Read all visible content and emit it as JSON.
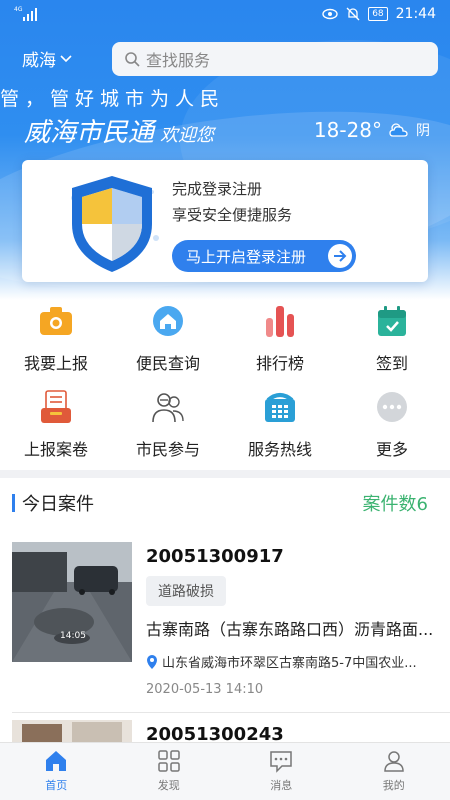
{
  "status_bar": {
    "network": "4G",
    "battery": "68",
    "time": "21:44"
  },
  "header": {
    "city": "威海",
    "search_placeholder": "查找服务",
    "marquee": "管，管好城市为人民",
    "brand": "威海市民通",
    "welcome": "欢迎您",
    "temperature": "18-28°",
    "weather": "阴"
  },
  "login_card": {
    "line1": "完成登录注册",
    "line2": "享受安全便捷服务",
    "button": "马上开启登录注册"
  },
  "services": [
    {
      "label": "我要上报",
      "icon": "camera-icon",
      "color": "#f5a623"
    },
    {
      "label": "便民查询",
      "icon": "home-search-icon",
      "color": "#4aa8f0"
    },
    {
      "label": "排行榜",
      "icon": "bar-chart-icon",
      "color": "#e55353"
    },
    {
      "label": "签到",
      "icon": "calendar-check-icon",
      "color": "#2bb39b"
    },
    {
      "label": "上报案卷",
      "icon": "document-tray-icon",
      "color": "#e05a3a"
    },
    {
      "label": "市民参与",
      "icon": "people-icon",
      "color": "#555555"
    },
    {
      "label": "服务热线",
      "icon": "telephone-icon",
      "color": "#2a9fd6"
    },
    {
      "label": "更多",
      "icon": "more-dots-icon",
      "color": "#bfc3c8"
    }
  ],
  "section": {
    "title": "今日案件",
    "count_label": "案件数6"
  },
  "cases": [
    {
      "id": "20051300917",
      "tag": "道路破损",
      "description": "古寨南路（古寨东路路口西）沥青路面...",
      "address": "山东省威海市环翠区古寨南路5-7中国农业...",
      "time": "2020-05-13 14:10",
      "thumb_caption": "14:05"
    },
    {
      "id": "20051300243"
    }
  ],
  "bottom_nav": [
    {
      "label": "首页",
      "icon": "home-icon",
      "active": true
    },
    {
      "label": "发现",
      "icon": "grid-icon",
      "active": false
    },
    {
      "label": "消息",
      "icon": "message-icon",
      "active": false
    },
    {
      "label": "我的",
      "icon": "user-icon",
      "active": false
    }
  ],
  "colors": {
    "primary": "#2f80ed",
    "count_green": "#3cb371"
  }
}
